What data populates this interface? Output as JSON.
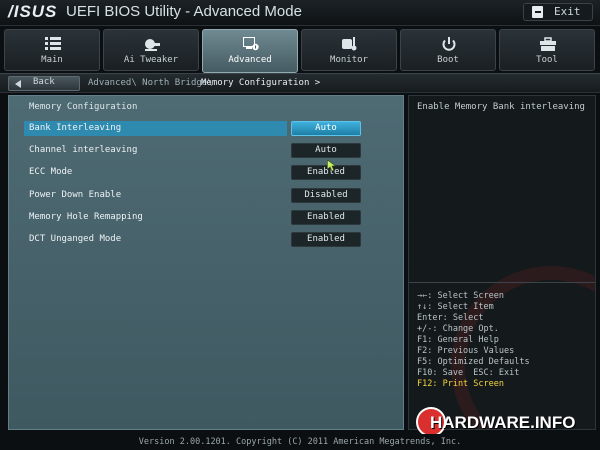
{
  "window": {
    "brand": "/ISUS",
    "title": "UEFI BIOS Utility - Advanced Mode",
    "exit_label": "Exit"
  },
  "tabs": [
    {
      "label": "Main",
      "icon": "list-icon"
    },
    {
      "label": "Ai Tweaker",
      "icon": "tweaker-icon"
    },
    {
      "label": "Advanced",
      "icon": "advanced-icon",
      "active": true
    },
    {
      "label": "Monitor",
      "icon": "monitor-gauge-icon"
    },
    {
      "label": "Boot",
      "icon": "power-icon"
    },
    {
      "label": "Tool",
      "icon": "toolbox-icon"
    }
  ],
  "breadcrumb": {
    "back_label": "Back",
    "path": "Advanced\\ North Bridge\\",
    "current": "Memory Configuration >"
  },
  "main": {
    "section_title": "Memory Configuration",
    "rows": [
      {
        "label": "Bank Interleaving",
        "value": "Auto",
        "selected": true
      },
      {
        "label": "Channel interleaving",
        "value": "Auto"
      },
      {
        "label": "ECC Mode",
        "value": "Enabled"
      },
      {
        "label": "Power Down Enable",
        "value": "Disabled"
      },
      {
        "label": "Memory Hole Remapping",
        "value": "Enabled"
      },
      {
        "label": "DCT Unganged Mode",
        "value": "Enabled"
      }
    ]
  },
  "help": {
    "text": "Enable Memory Bank interleaving",
    "keys": [
      "→←: Select Screen",
      "↑↓: Select Item",
      "Enter: Select",
      "+/-: Change Opt.",
      "F1: General Help",
      "F2: Previous Values",
      "F5: Optimized Defaults",
      "F10: Save  ESC: Exit",
      "F12: Print Screen"
    ]
  },
  "watermark": {
    "logo_text": "HARDWARE.INFO"
  },
  "footer": {
    "text": "Version 2.00.1201. Copyright (C) 2011 American Megatrends, Inc."
  },
  "colors": {
    "panel": "#4e6a73",
    "selection": "#2f8ab0",
    "highlight_key": "#f5d43a"
  }
}
